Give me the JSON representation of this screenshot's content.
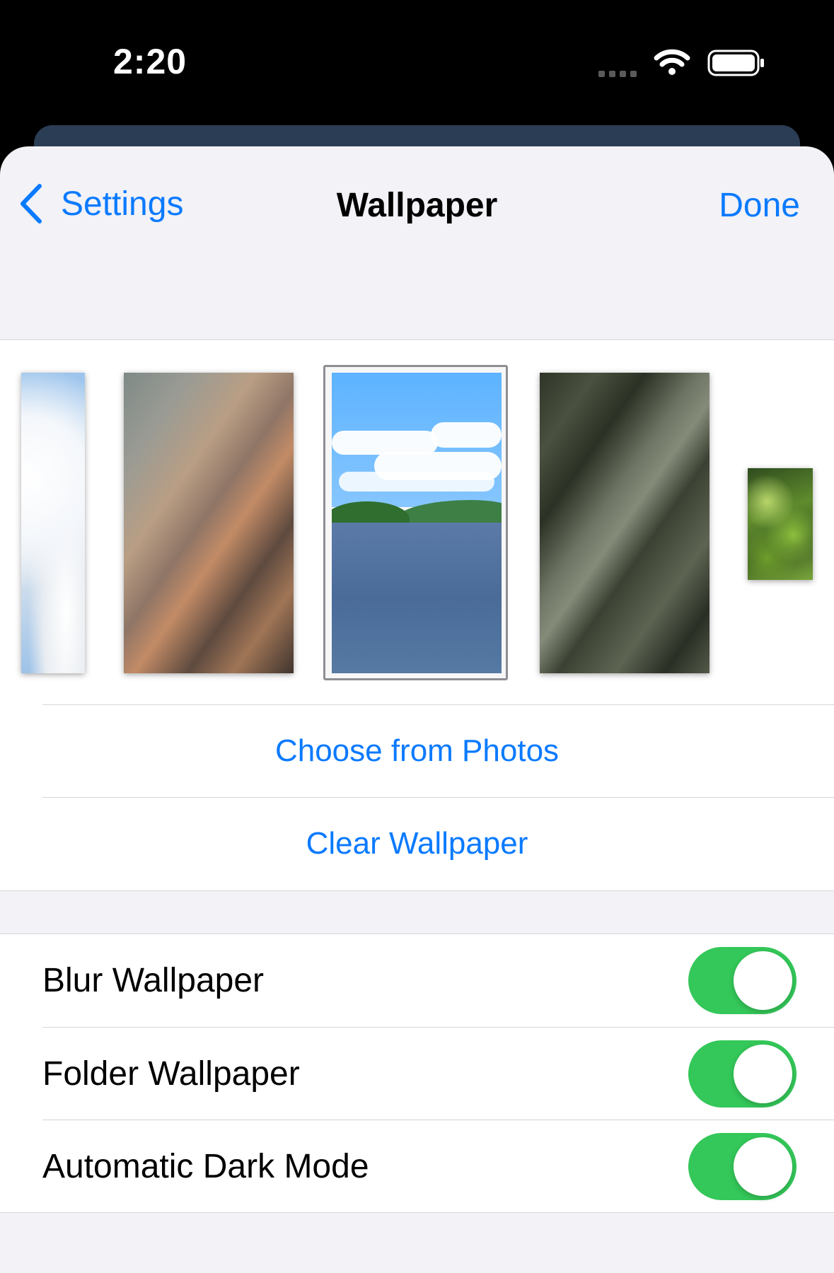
{
  "status_bar": {
    "time": "2:20"
  },
  "nav": {
    "back_label": "Settings",
    "title": "Wallpaper",
    "done_label": "Done"
  },
  "wallpapers": [
    {
      "name": "sky-clouds",
      "selected": false
    },
    {
      "name": "warm-blur",
      "selected": false
    },
    {
      "name": "lake",
      "selected": true
    },
    {
      "name": "dark-green-blur",
      "selected": false
    },
    {
      "name": "leaves",
      "selected": false
    }
  ],
  "actions": {
    "choose_from_photos": "Choose from Photos",
    "clear_wallpaper": "Clear Wallpaper"
  },
  "toggles": [
    {
      "label": "Blur Wallpaper",
      "on": true
    },
    {
      "label": "Folder Wallpaper",
      "on": true
    },
    {
      "label": "Automatic Dark Mode",
      "on": true
    }
  ],
  "colors": {
    "accent": "#0a7aff",
    "switch_on": "#34c759",
    "background": "#f2f2f7"
  }
}
